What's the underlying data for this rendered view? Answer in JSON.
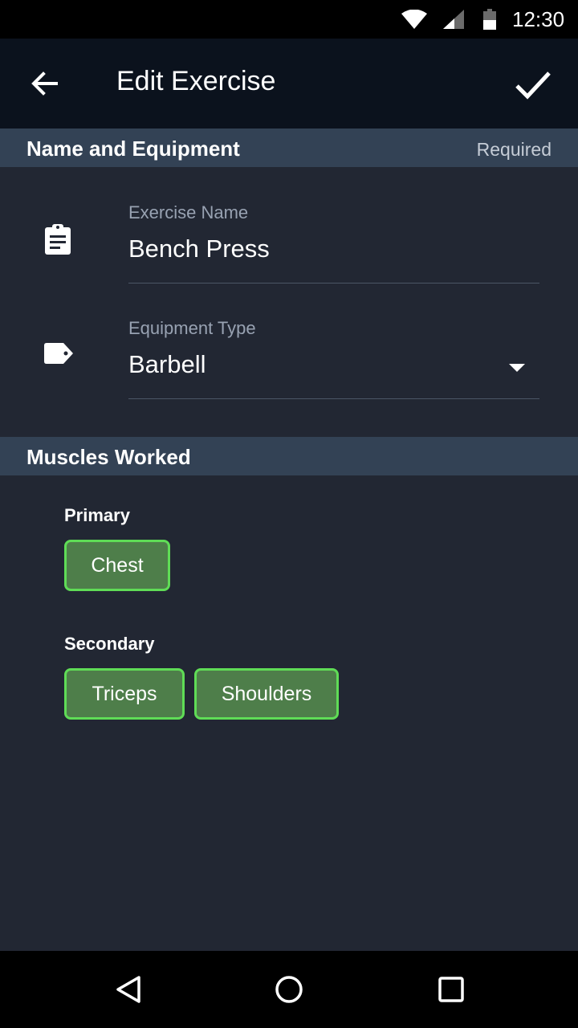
{
  "status_bar": {
    "time": "12:30",
    "icons": [
      "wifi-icon",
      "cellular-signal-icon",
      "battery-icon"
    ]
  },
  "app_bar": {
    "title": "Edit Exercise",
    "back_icon": "arrow-back-icon",
    "confirm_icon": "checkmark-icon"
  },
  "sections": {
    "name_equipment": {
      "title": "Name and Equipment",
      "aside": "Required"
    },
    "muscles": {
      "title": "Muscles Worked"
    }
  },
  "fields": {
    "exercise_name": {
      "label": "Exercise Name",
      "value": "Bench Press",
      "icon": "clipboard-icon"
    },
    "equipment_type": {
      "label": "Equipment Type",
      "value": "Barbell",
      "icon": "tag-icon"
    }
  },
  "muscles": {
    "primary": {
      "label": "Primary",
      "chips": [
        "Chest"
      ]
    },
    "secondary": {
      "label": "Secondary",
      "chips": [
        "Triceps",
        "Shoulders"
      ]
    }
  },
  "colors": {
    "background": "#222733",
    "app_bar": "#0b121d",
    "section_header": "#334255",
    "chip_fill": "#4e7e4a",
    "chip_border": "#5fdc56"
  },
  "nav_bar": {
    "icons": [
      "back-triangle-icon",
      "home-circle-icon",
      "recents-square-icon"
    ]
  }
}
